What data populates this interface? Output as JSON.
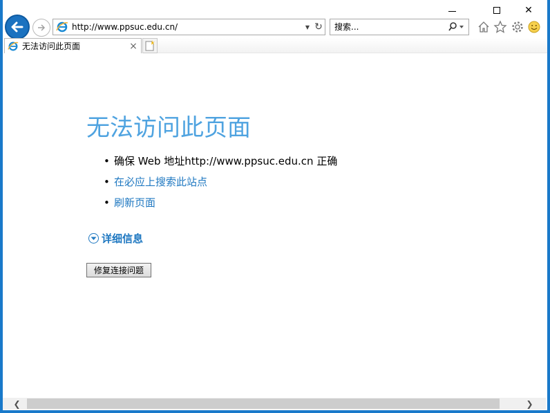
{
  "window": {
    "minimize_glyph": "",
    "close_glyph": "✕"
  },
  "nav": {
    "address": "http://www.ppsuc.edu.cn/",
    "search_placeholder": "搜索...",
    "dropdown_glyph": "▼",
    "refresh_glyph": "↻"
  },
  "icons": {
    "back": "arrow-left-icon",
    "forward": "arrow-right-icon",
    "browser": "ie-logo-icon",
    "search": "magnifier-icon",
    "home": "home-icon",
    "favorites": "star-icon",
    "settings": "gear-icon",
    "feedback": "smiley-icon"
  },
  "tab": {
    "title": "无法访问此页面",
    "close_glyph": "×"
  },
  "page": {
    "title": "无法访问此页面",
    "suggestions": [
      {
        "text": "确保 Web 地址http://www.ppsuc.edu.cn 正确",
        "link": false
      },
      {
        "text": "在必应上搜索此站点",
        "link": true
      },
      {
        "text": "刷新页面",
        "link": true
      }
    ],
    "bullet": "•",
    "details_label": "详细信息",
    "fix_button": "修复连接问题"
  },
  "scrollbar": {
    "left_glyph": "❮",
    "right_glyph": "❯"
  },
  "colors": {
    "accent": "#1979ca",
    "title_blue": "#4fa3e0",
    "link_blue": "#1f78c1"
  }
}
